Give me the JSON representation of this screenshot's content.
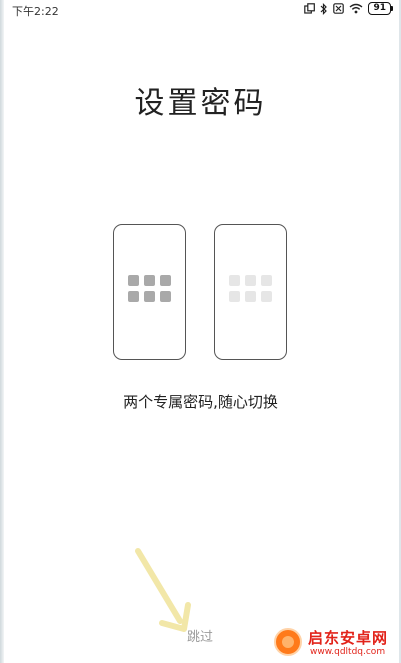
{
  "status_bar": {
    "time": "下午2:22",
    "battery": "91",
    "icons": [
      "dual-window-icon",
      "bluetooth-icon",
      "no-sim-icon",
      "wifi-icon",
      "battery-icon"
    ]
  },
  "title": "设置密码",
  "illustration": {
    "icons": [
      "phone-left-icon",
      "phone-right-icon"
    ]
  },
  "subtitle": "两个专属密码,随心切换",
  "skip_label": "跳过",
  "watermark": {
    "title": "启东安卓网",
    "url": "www.qdltdq.com"
  },
  "colors": {
    "background": "#ffffff",
    "text": "#222222",
    "skip": "#9a9a9a",
    "grid_active": "#a9a9a9",
    "grid_inactive": "#e6e6e6",
    "annotation_arrow": "#f2e7a8",
    "watermark": "#e2231a"
  }
}
